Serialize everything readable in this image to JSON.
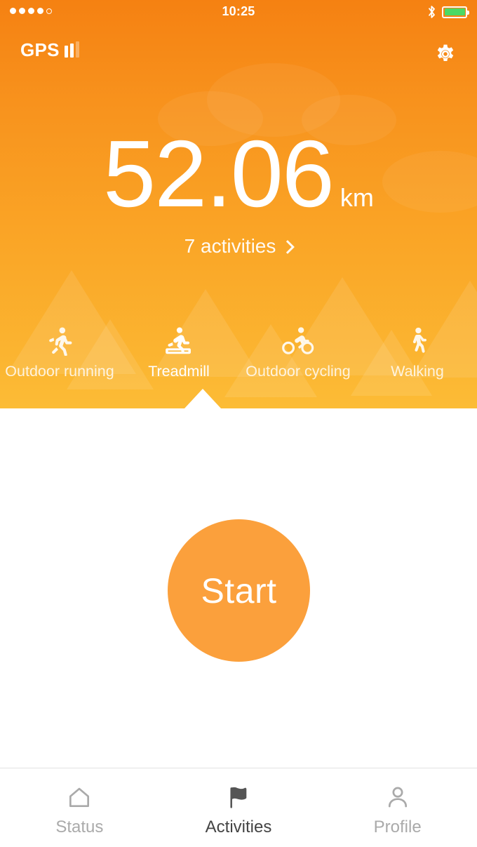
{
  "status_bar": {
    "signal_dots_filled": 4,
    "signal_dots_total": 5,
    "time": "10:25",
    "bluetooth_icon": "bluetooth-icon",
    "battery_icon": "battery-icon",
    "battery_level_percent": 100,
    "battery_color": "#4CD964"
  },
  "nav": {
    "gps_label": "GPS",
    "gps_signal_bars_active": 2,
    "gps_signal_bars_total": 3,
    "settings_icon": "gear-icon"
  },
  "summary": {
    "distance_value": "52.06",
    "distance_unit": "km",
    "activities_link_label": "7 activities",
    "activities_link_chevron": "chevron-right-icon"
  },
  "activity_selector": {
    "selected_index": 1,
    "items": [
      {
        "label": "Outdoor running",
        "icon": "running-icon"
      },
      {
        "label": "Treadmill",
        "icon": "treadmill-icon"
      },
      {
        "label": "Outdoor cycling",
        "icon": "cycling-icon"
      },
      {
        "label": "Walking",
        "icon": "walking-icon"
      }
    ]
  },
  "main": {
    "start_button_label": "Start"
  },
  "tab_bar": {
    "selected_index": 1,
    "items": [
      {
        "label": "Status",
        "icon": "home-icon"
      },
      {
        "label": "Activities",
        "icon": "flag-icon"
      },
      {
        "label": "Profile",
        "icon": "person-icon"
      }
    ]
  },
  "colors": {
    "header_top": "#F58112",
    "header_bottom": "#FCBC36",
    "start_button": "#FBA03C",
    "tab_selected": "#444444",
    "tab_inactive": "#aaaaaa"
  }
}
